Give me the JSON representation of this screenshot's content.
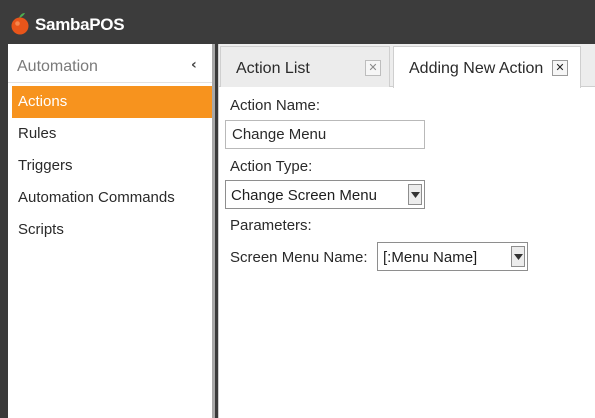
{
  "app": {
    "title": "SambaPOS",
    "logo_icon": "orange-fruit-icon",
    "brand_color": "#f7931e"
  },
  "sidebar": {
    "title": "Automation",
    "collapse_icon": "chevron-left-icon",
    "items": [
      {
        "label": "Actions",
        "active": true
      },
      {
        "label": "Rules"
      },
      {
        "label": "Triggers"
      },
      {
        "label": "Automation Commands"
      },
      {
        "label": "Scripts"
      }
    ]
  },
  "tabs": [
    {
      "label": "Action List",
      "close_icon": "close-icon",
      "active": false
    },
    {
      "label": "Adding New Action",
      "close_icon": "close-icon",
      "active": true
    }
  ],
  "form": {
    "action_name_label": "Action Name:",
    "action_name_value": "Change Menu",
    "action_type_label": "Action Type:",
    "action_type_value": "Change Screen Menu",
    "parameters_label": "Parameters:",
    "screen_menu_name_label": "Screen Menu Name:",
    "screen_menu_name_value": "[:Menu Name]"
  }
}
